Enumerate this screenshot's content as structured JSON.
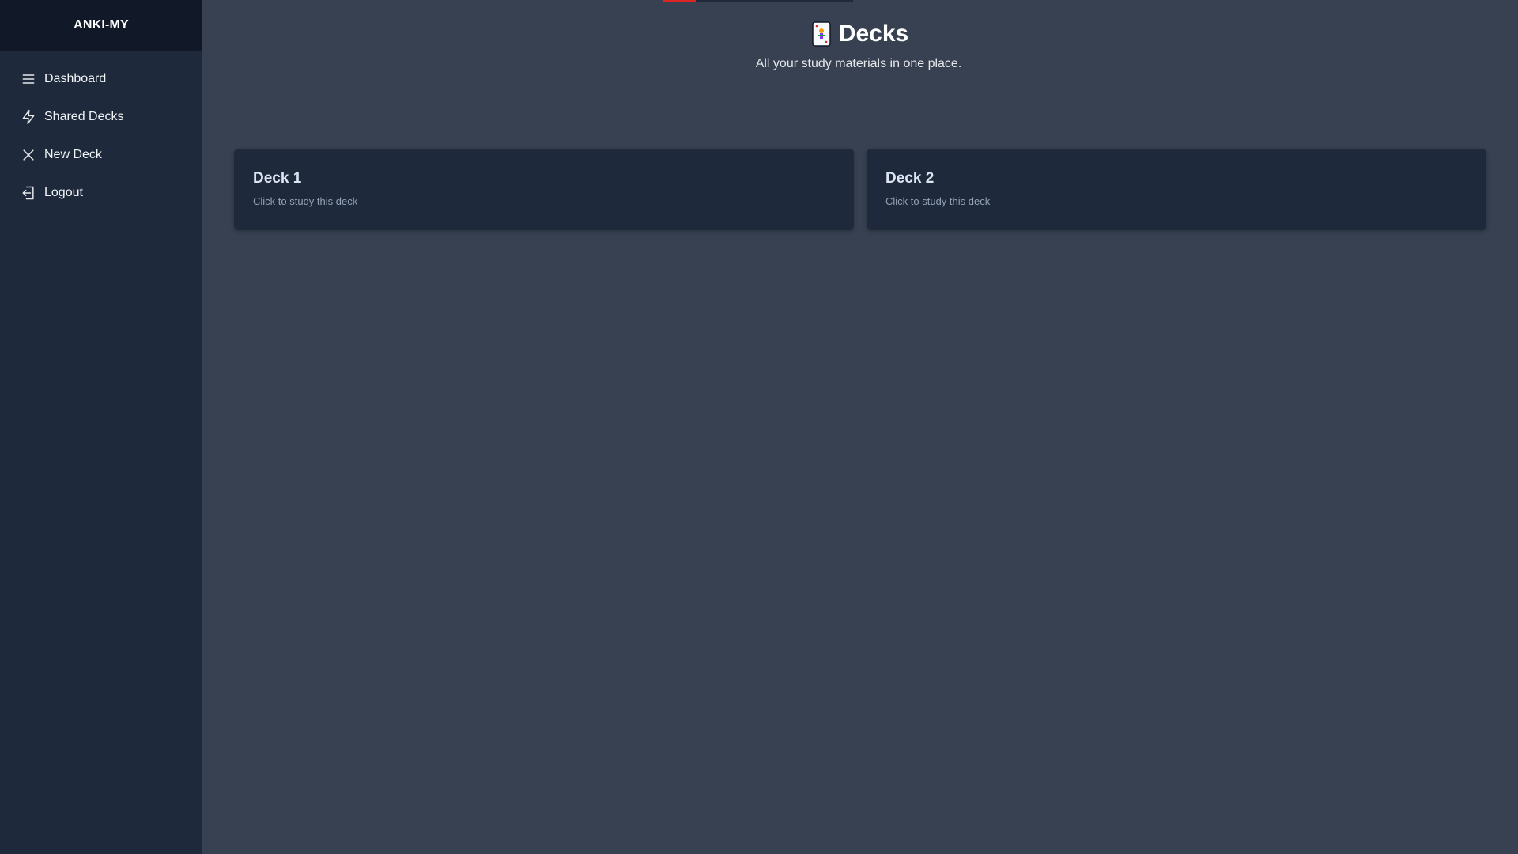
{
  "app": {
    "brand": "ANKI-MY"
  },
  "sidebar": {
    "items": [
      {
        "label": "Dashboard",
        "icon": "menu-icon"
      },
      {
        "label": "Shared Decks",
        "icon": "lightning-icon"
      },
      {
        "label": "New Deck",
        "icon": "close-icon"
      },
      {
        "label": "Logout",
        "icon": "logout-icon"
      }
    ]
  },
  "header": {
    "icon": "card-deck-icon",
    "title": "Decks",
    "subtitle": "All your study materials in one place."
  },
  "progress": {
    "fraction": 0.17,
    "color": "#dc2626"
  },
  "decks": [
    {
      "title": "Deck 1",
      "subtitle": "Click to study this deck"
    },
    {
      "title": "Deck 2",
      "subtitle": "Click to study this deck"
    }
  ],
  "colors": {
    "page_background": "#374151",
    "sidebar_background": "#1e293b",
    "brand_background": "#111827",
    "card_background": "#1e293b"
  }
}
